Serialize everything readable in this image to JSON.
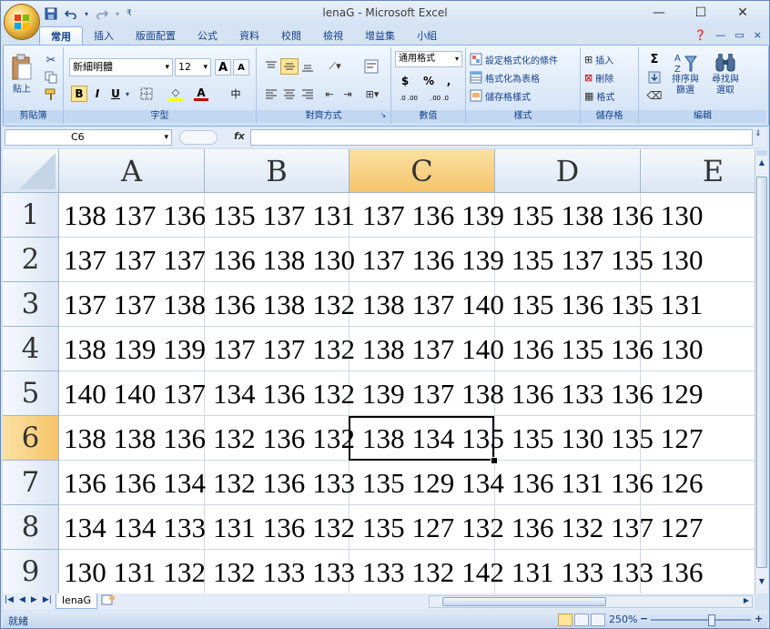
{
  "window": {
    "title": "lenaG - Microsoft Excel",
    "minimize": "—",
    "maximize": "☐",
    "close": "✕"
  },
  "quick_access": {
    "save_icon": "save-icon",
    "undo_icon": "undo-icon",
    "redo_icon": "redo-icon"
  },
  "tabs": [
    "常用",
    "插入",
    "版面配置",
    "公式",
    "資料",
    "校閱",
    "檢視",
    "增益集",
    "小組"
  ],
  "active_tab": "常用",
  "ribbon": {
    "clipboard": {
      "label": "剪貼簿",
      "paste": "貼上"
    },
    "font": {
      "label": "字型",
      "font_name": "新細明體",
      "font_size": "12",
      "grow": "A",
      "shrink": "A",
      "bold": "B",
      "italic": "I",
      "underline": "U",
      "font_color_letter": "A",
      "phonetic": "中",
      "color_accent": "#c00000",
      "fill_accent": "#ffff00"
    },
    "alignment": {
      "label": "對齊方式"
    },
    "number": {
      "label": "數值",
      "format": "通用格式",
      "currency": "$",
      "percent": "%",
      "comma": ",",
      "inc_decimal": ".0 .00",
      "dec_decimal": ".00 .0"
    },
    "styles": {
      "label": "樣式",
      "conditional": "設定格式化的條件",
      "as_table": "格式化為表格",
      "cell_styles": "儲存格樣式"
    },
    "cells": {
      "label": "儲存格",
      "insert": "插入",
      "delete": "刪除",
      "format": "格式"
    },
    "editing": {
      "label": "編輯",
      "sigma": "Σ",
      "sort": "排序與\n篩選",
      "find": "尋找與\n選取"
    }
  },
  "formula_bar": {
    "name_box": "C6",
    "fx": "fx",
    "content": ""
  },
  "grid": {
    "columns": [
      "A",
      "B",
      "C",
      "D",
      "E"
    ],
    "selected_column": "C",
    "selected_row": "6",
    "rows": [
      {
        "num": "1",
        "text": "138 137 136 135 137 131 137 136 139 135 138 136 130"
      },
      {
        "num": "2",
        "text": "137 137 137 136 138 130 137 136 139 135 137 135 130"
      },
      {
        "num": "3",
        "text": "137 137 138 136 138 132 138 137 140 135 136 135 131"
      },
      {
        "num": "4",
        "text": "138 139 139 137 137 132 138 137 140 136 135 136 130"
      },
      {
        "num": "5",
        "text": "140 140 137 134 136 132 139 137 138 136 133 136 129"
      },
      {
        "num": "6",
        "text": "138 138 136 132 136 132 138 134 135 135 130 135 127"
      },
      {
        "num": "7",
        "text": "136 136 134 132 136 133 135 129 134 136 131 136 126"
      },
      {
        "num": "8",
        "text": "134 134 133 131 136 132 135 127 132 136 132 137 127"
      },
      {
        "num": "9",
        "text": "130 131 132 132 133 133 133 132 142 131 133 133 136"
      }
    ]
  },
  "sheet_tabs": {
    "active": "lenaG"
  },
  "status_bar": {
    "ready": "就緒",
    "zoom": "250%",
    "zoom_out": "−",
    "zoom_in": "+"
  }
}
